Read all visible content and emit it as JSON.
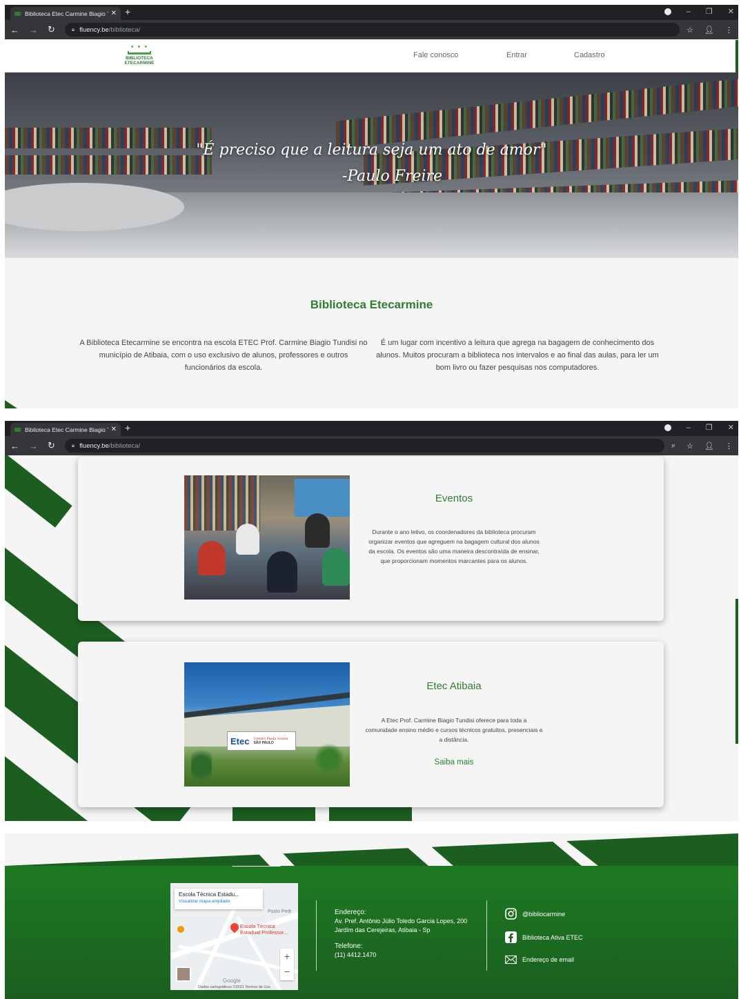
{
  "browser": {
    "tab_title": "Biblioteca Etec Carmine Biagio T",
    "url_host": "fluency.be",
    "url_path": "/biblioteca/"
  },
  "site": {
    "logo_text_1": "BIBLIOTECA",
    "logo_text_2": "ETECARMINE",
    "nav": [
      "Fale conosco",
      "Entrar",
      "Cadastro"
    ],
    "hero_quote_1": "\"É preciso que a leitura seja um ato de amor\"",
    "hero_quote_2": "-Paulo Freire",
    "about_title": "Biblioteca Etecarmine",
    "about_left": "A Biblioteca Etecarmine se encontra na escola ETEC Prof. Carmine Biagio Tundisi no município de Atibaia, com o uso exclusivo de alunos, professores e outros funcionários da escola.",
    "about_right": "É um lugar com incentivo a leitura que agrega na bagagem de conhecimento dos alunos. Muitos procuram a biblioteca nos intervalos e ao final das aulas, para ler um bom livro ou fazer pesquisas nos computadores."
  },
  "cards": [
    {
      "title": "Eventos",
      "text": "Durante o ano letivo, os coordenadores da biblioteca procuram organizar eventos que agreguem na bagagem cultural dos alunos da escola. Os eventos são uma maneira descontraída de ensinar, que proporcionam momentos marcantes para os alunos."
    },
    {
      "title": "Etec Atibaia",
      "text": "A Etec Prof. Carmine Biagio Tundisi oferece para toda a comunidade ensino médio e cursos técnicos gratuitos, presenciais e a distância.",
      "link": "Saiba mais",
      "sign_main": "Etec",
      "sign_sub": "Centro Paula Souza",
      "sign_state": "SÃO PAULO"
    }
  ],
  "footer": {
    "map_title": "Escola Técnica Estadu...",
    "map_link": "Visualizar mapa ampliado",
    "map_pin_label_1": "Escola Técnica",
    "map_pin_label_2": "Estadual Professor...",
    "map_poi": "Posto Pedr",
    "map_google": "Google",
    "map_attr": "Dados cartográficos ©2021   Termos de Uso",
    "zoom_in": "+",
    "zoom_out": "−",
    "address_label": "Endereço:",
    "address_line1": "Av. Pref. Antônio Júlio Toledo Garcia Lopes, 200",
    "address_line2": "Jardim das Cerejeiras, Atibaia - Sp",
    "phone_label": "Telefone:",
    "phone": "(11) 4412.1470",
    "instagram": "@bibliocarmine",
    "facebook": "Biblioteca Ativa ETEC",
    "email": "Endereço de email"
  },
  "colors": {
    "brand_green": "#2e7d32",
    "dark_green": "#1b5e20"
  }
}
